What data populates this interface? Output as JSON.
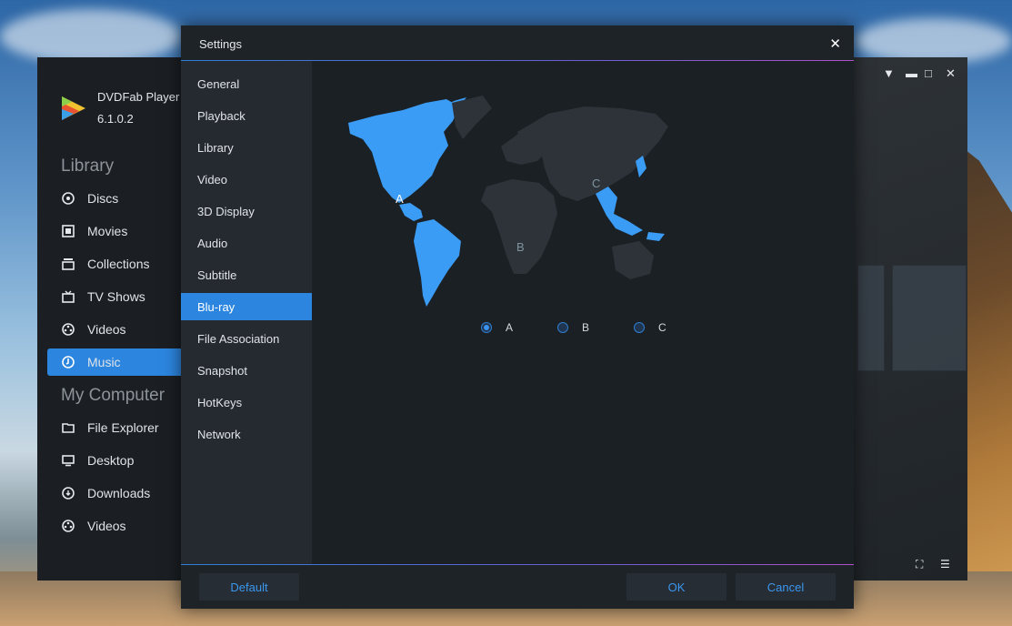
{
  "player": {
    "app_name": "DVDFab Player",
    "version": "6.1.0.2",
    "library_title": "Library",
    "library_items": [
      {
        "label": "Discs",
        "icon": "disc-icon"
      },
      {
        "label": "Movies",
        "icon": "film-icon"
      },
      {
        "label": "Collections",
        "icon": "stack-icon"
      },
      {
        "label": "TV Shows",
        "icon": "tv-icon"
      },
      {
        "label": "Videos",
        "icon": "reel-icon"
      },
      {
        "label": "Music",
        "icon": "music-icon",
        "active": true
      }
    ],
    "computer_title": "My Computer",
    "computer_items": [
      {
        "label": "File Explorer",
        "icon": "folder-icon"
      },
      {
        "label": "Desktop",
        "icon": "monitor-icon"
      },
      {
        "label": "Downloads",
        "icon": "download-icon"
      },
      {
        "label": "Videos",
        "icon": "reel-icon"
      }
    ],
    "accent_color": "#2c86e0"
  },
  "settings": {
    "title": "Settings",
    "menu": [
      "General",
      "Playback",
      "Library",
      "Video",
      "3D Display",
      "Audio",
      "Subtitle",
      "Blu-ray",
      "File Association",
      "Snapshot",
      "HotKeys",
      "Network"
    ],
    "active_menu": "Blu-ray",
    "regions": {
      "map_labels": {
        "a": "A",
        "b": "B",
        "c": "C"
      },
      "options": [
        "A",
        "B",
        "C"
      ],
      "selected": "A",
      "highlight_color": "#3b9cf5",
      "land_color": "#2d3338"
    },
    "buttons": {
      "default": "Default",
      "ok": "OK",
      "cancel": "Cancel"
    }
  }
}
